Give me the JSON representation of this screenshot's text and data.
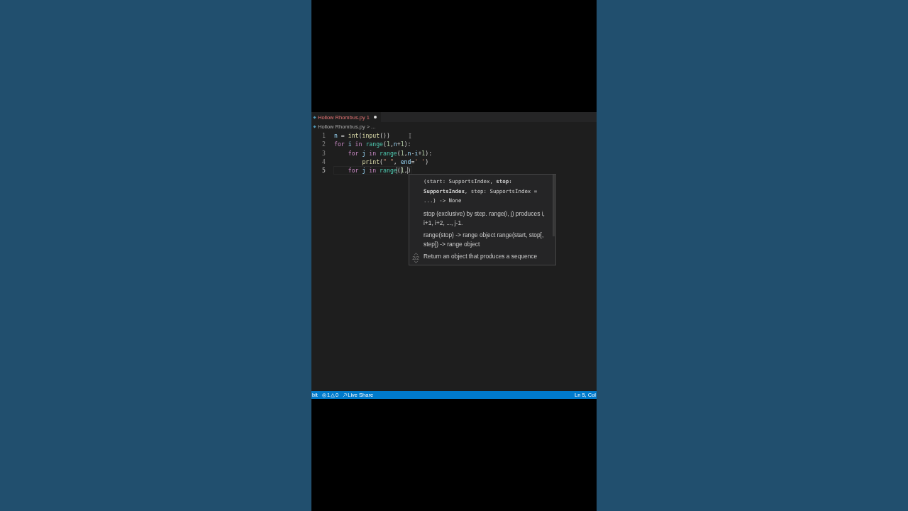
{
  "tab": {
    "label": "Hollow Rhombus.py",
    "badge": "1",
    "modified": true
  },
  "breadcrumb": {
    "file": "Hollow Rhombus.py",
    "separator": ">",
    "rest": "..."
  },
  "code": {
    "lines": [
      {
        "number": "1",
        "current": false,
        "tokens": [
          {
            "kind": "var",
            "text": "n"
          },
          {
            "kind": "plain",
            "text": " = "
          },
          {
            "kind": "func",
            "text": "int"
          },
          {
            "kind": "plain",
            "text": "("
          },
          {
            "kind": "func",
            "text": "input"
          },
          {
            "kind": "plain",
            "text": "())"
          }
        ]
      },
      {
        "number": "2",
        "current": false,
        "tokens": [
          {
            "kind": "keyword",
            "text": "for"
          },
          {
            "kind": "var",
            "text": " i"
          },
          {
            "kind": "keyword",
            "text": " in"
          },
          {
            "kind": "class",
            "text": " range"
          },
          {
            "kind": "plain",
            "text": "("
          },
          {
            "kind": "number",
            "text": "1"
          },
          {
            "kind": "plain",
            "text": ","
          },
          {
            "kind": "var",
            "text": "n"
          },
          {
            "kind": "plain",
            "text": "+"
          },
          {
            "kind": "number",
            "text": "1"
          },
          {
            "kind": "plain",
            "text": "):"
          }
        ]
      },
      {
        "number": "3",
        "current": false,
        "tokens": [
          {
            "kind": "keyword",
            "text": "    for"
          },
          {
            "kind": "var",
            "text": " j"
          },
          {
            "kind": "keyword",
            "text": " in"
          },
          {
            "kind": "class",
            "text": " range"
          },
          {
            "kind": "plain",
            "text": "("
          },
          {
            "kind": "number",
            "text": "1"
          },
          {
            "kind": "plain",
            "text": ","
          },
          {
            "kind": "var",
            "text": "n"
          },
          {
            "kind": "plain",
            "text": "-"
          },
          {
            "kind": "var",
            "text": "i"
          },
          {
            "kind": "plain",
            "text": "+"
          },
          {
            "kind": "number",
            "text": "1"
          },
          {
            "kind": "plain",
            "text": "):"
          }
        ]
      },
      {
        "number": "4",
        "current": false,
        "tokens": [
          {
            "kind": "func",
            "text": "        print"
          },
          {
            "kind": "plain",
            "text": "("
          },
          {
            "kind": "string",
            "text": "\" \""
          },
          {
            "kind": "plain",
            "text": ", "
          },
          {
            "kind": "var",
            "text": "end"
          },
          {
            "kind": "plain",
            "text": "="
          },
          {
            "kind": "string",
            "text": "' '"
          },
          {
            "kind": "plain",
            "text": ")"
          }
        ]
      },
      {
        "number": "5",
        "current": true,
        "tokens": [
          {
            "kind": "keyword",
            "text": "    for"
          },
          {
            "kind": "var",
            "text": " j"
          },
          {
            "kind": "keyword",
            "text": " in"
          },
          {
            "kind": "class",
            "text": " range"
          },
          {
            "kind": "match",
            "text": "("
          },
          {
            "kind": "number",
            "text": "1"
          },
          {
            "kind": "plain",
            "text": ","
          },
          {
            "kind": "match",
            "text": ")"
          }
        ]
      }
    ]
  },
  "hover": {
    "signature": "(start: SupportsIndex, **stop: SupportsIndex**, step: SupportsIndex = ...) -> None",
    "docs": [
      "stop (exclusive) by step.  range(i, j) produces i, i+1, i+2, ..., j-1.",
      "range(stop) -> range object range(start, stop[, step]) -> range object",
      "Return an object that produces a sequence"
    ],
    "counter": "2/2"
  },
  "status_bar": {
    "left": [
      {
        "kind": "branch",
        "label": "bit"
      },
      {
        "kind": "problems",
        "errors": "1",
        "warnings": "0"
      },
      {
        "kind": "liveshare",
        "label": "Live Share"
      }
    ],
    "right": "Ln 5, Col"
  }
}
